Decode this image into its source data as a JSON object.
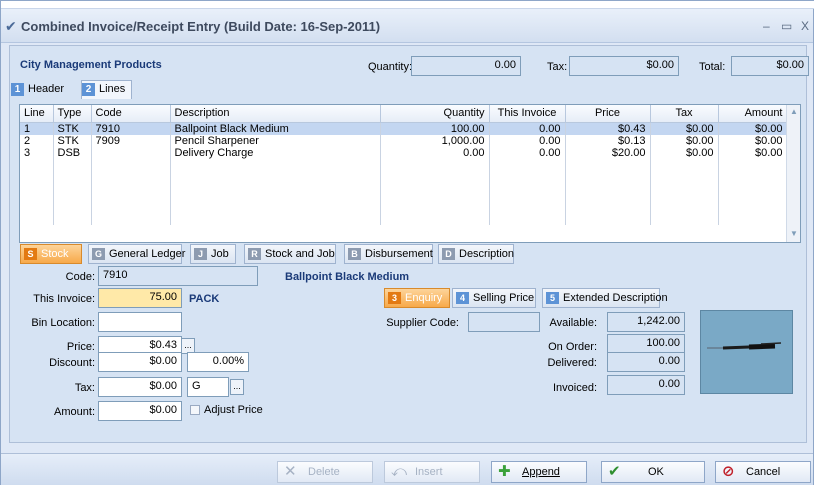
{
  "window": {
    "title": "Combined Invoice/Receipt Entry (Build Date: 16-Sep-2011)",
    "minimize": "–",
    "maximize": "▭",
    "close": "X"
  },
  "header": {
    "company": "City Management Products",
    "quantity_label": "Quantity:",
    "quantity_value": "0.00",
    "tax_label": "Tax:",
    "tax_value": "$0.00",
    "total_label": "Total:",
    "total_value": "$0.00"
  },
  "tabs": [
    {
      "num": "1",
      "label": "Header"
    },
    {
      "num": "2",
      "label": "Lines"
    }
  ],
  "grid": {
    "columns": [
      "Line",
      "Type",
      "Code",
      "Description",
      "Quantity",
      "This Invoice",
      "Price",
      "Tax",
      "Amount"
    ],
    "rows": [
      {
        "line": "1",
        "type": "STK",
        "code": "7910",
        "description": "Ballpoint Black Medium",
        "quantity": "100.00",
        "this_invoice": "0.00",
        "price": "$0.43",
        "tax": "$0.00",
        "amount": "$0.00"
      },
      {
        "line": "2",
        "type": "STK",
        "code": "7909",
        "description": "Pencil Sharpener",
        "quantity": "1,000.00",
        "this_invoice": "0.00",
        "price": "$0.13",
        "tax": "$0.00",
        "amount": "$0.00"
      },
      {
        "line": "3",
        "type": "DSB",
        "code": "",
        "description": "Delivery Charge",
        "quantity": "0.00",
        "this_invoice": "0.00",
        "price": "$20.00",
        "tax": "$0.00",
        "amount": "$0.00"
      }
    ]
  },
  "line_types": [
    {
      "key": "S",
      "label": "Stock"
    },
    {
      "key": "G",
      "label": "General Ledger"
    },
    {
      "key": "J",
      "label": "Job"
    },
    {
      "key": "R",
      "label": "Stock and Job"
    },
    {
      "key": "B",
      "label": "Disbursement"
    },
    {
      "key": "D",
      "label": "Description"
    }
  ],
  "detail": {
    "code_label": "Code:",
    "code_value": "7910",
    "description": "Ballpoint Black Medium",
    "this_invoice_label": "This Invoice:",
    "this_invoice_value": "75.00",
    "unit": "PACK",
    "bin_label": "Bin Location:",
    "bin_value": "",
    "price_label": "Price:",
    "price_value": "$0.43",
    "discount_label": "Discount:",
    "discount_value": "$0.00",
    "discount_pct": "0.00%",
    "tax_label": "Tax:",
    "tax_value": "$0.00",
    "tax_code": "G",
    "amount_label": "Amount:",
    "amount_value": "$0.00",
    "adjust_price": "Adjust Price",
    "dots": "..."
  },
  "subtabs": [
    {
      "key": "3",
      "label": "Enquiry"
    },
    {
      "key": "4",
      "label": "Selling Price"
    },
    {
      "key": "5",
      "label": "Extended Description"
    }
  ],
  "enquiry": {
    "supplier_code_label": "Supplier Code:",
    "supplier_code_value": "",
    "available_label": "Available:",
    "available_value": "1,242.00",
    "on_order_label": "On Order:",
    "on_order_value": "100.00",
    "delivered_label": "Delivered:",
    "delivered_value": "0.00",
    "invoiced_label": "Invoiced:",
    "invoiced_value": "0.00"
  },
  "buttons": {
    "delete": "Delete",
    "insert": "Insert",
    "append": "Append",
    "ok": "OK",
    "cancel": "Cancel"
  },
  "colors": {
    "accent_orange": "#f7a94a",
    "tab_blue": "#5d93d6",
    "field_yellow": "#ffe9a8"
  }
}
